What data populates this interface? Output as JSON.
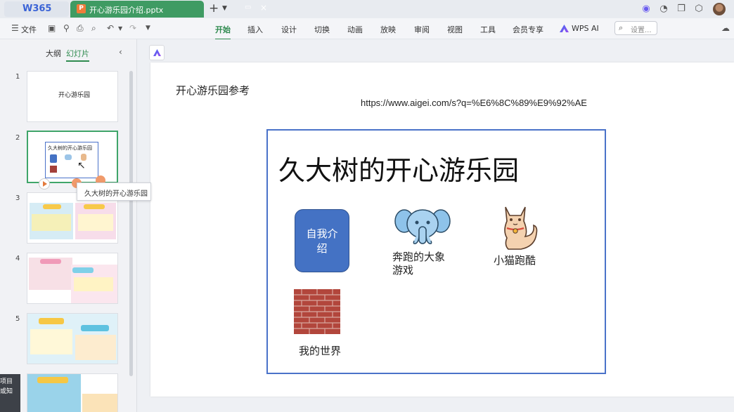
{
  "titlebar": {
    "home_tab": "W365",
    "doc_tab": "开心游乐园介绍.pptx",
    "doc_icon_letter": "P"
  },
  "toolbar": {
    "file_label": "文件",
    "ribbon_tabs": [
      "开始",
      "插入",
      "设计",
      "切换",
      "动画",
      "放映",
      "审阅",
      "视图",
      "工具",
      "会员专享"
    ],
    "active_tab": "开始",
    "wps_ai_label": "WPS AI",
    "search_placeholder": "设置..."
  },
  "left_panel": {
    "tab_outline": "大纲",
    "tab_slides": "幻灯片",
    "slide_numbers": [
      "1",
      "2",
      "3",
      "4",
      "5",
      "6"
    ],
    "thumb1_title": "开心游乐园",
    "thumb2_heading": "久大树的开心游乐园",
    "tooltip": "久大树的开心游乐园",
    "float_lines": [
      "项目",
      "或知"
    ]
  },
  "slide": {
    "title": "开心游乐园参考",
    "url": "https://www.aigei.com/s?q=%E6%8C%89%E9%92%AE",
    "heading": "久大树的开心游乐园",
    "intro_button": "自我介绍",
    "elephant_label_line1": "奔跑的大象",
    "elephant_label_line2": "游戏",
    "cat_label": "小猫跑酷",
    "world_label": "我的世界"
  },
  "colors": {
    "accent_green": "#2f8b4f",
    "doc_tab_green": "#3f9b63",
    "frame_blue": "#4a72c9",
    "button_blue": "#4472c4"
  }
}
